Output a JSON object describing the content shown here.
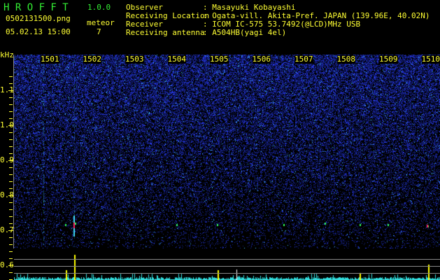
{
  "app": {
    "name": "H R O F F T",
    "version": "1.0.0"
  },
  "file": {
    "name": "0502131500.png",
    "datetime": "05.02.13 15:00"
  },
  "meteor": {
    "label": "meteor",
    "count": "7"
  },
  "info": [
    {
      "label": "Observer",
      "value": ": Masayuki Kobayashi"
    },
    {
      "label": "Receiving Location",
      "value": ": Ogata-vill. Akita-Pref. JAPAN (139.96E, 40.02N)"
    },
    {
      "label": "Receiver",
      "value": ": ICOM IC-575 53.7492(@LCD)MHz USB"
    },
    {
      "label": "Receiving antenna",
      "value": ": A504HB(yagi 4el)"
    }
  ],
  "axis": {
    "unit": "kHz",
    "y_ticks": [
      "1.1",
      "1.0",
      "0.9",
      "0.8",
      "0.7",
      "0.6"
    ],
    "x_ticks": [
      "1501",
      "1502",
      "1503",
      "1504",
      "1505",
      "1506",
      "1507",
      "1508",
      "1509",
      "1510"
    ]
  },
  "colors": {
    "text": "#ffff33",
    "title": "#33ee33",
    "noise": "#1a2ad0",
    "level": "#33dddd"
  }
}
